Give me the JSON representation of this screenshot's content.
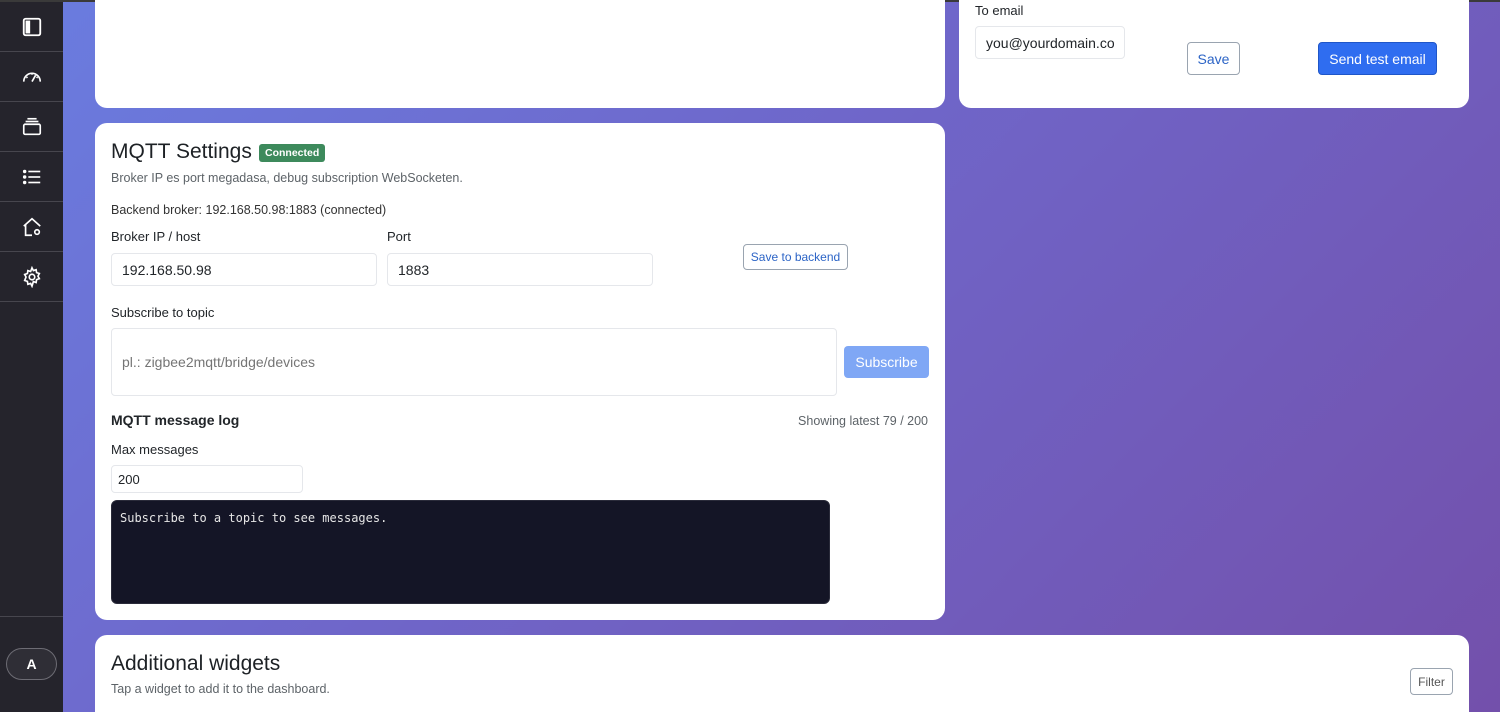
{
  "sidebar": {
    "items": [
      {
        "icon": "sidebar-toggle-icon"
      },
      {
        "icon": "speedometer-icon"
      },
      {
        "icon": "stack-icon"
      },
      {
        "icon": "list-icon"
      },
      {
        "icon": "home-settings-icon"
      },
      {
        "icon": "gear-icon"
      }
    ],
    "avatar_initial": "A"
  },
  "email_card": {
    "to_email_label": "To email",
    "to_email_value": "you@yourdomain.co",
    "save_label": "Save",
    "send_test_label": "Send test email"
  },
  "mqtt": {
    "title": "MQTT Settings",
    "status_badge": "Connected",
    "description": "Broker IP es port megadasa, debug subscription WebSocketen.",
    "backend_broker": "Backend broker: 192.168.50.98:1883 (connected)",
    "broker_label": "Broker IP / host",
    "broker_value": "192.168.50.98",
    "port_label": "Port",
    "port_value": "1883",
    "save_backend_label": "Save to backend",
    "subscribe_label": "Subscribe to topic",
    "subscribe_placeholder": "pl.: zigbee2mqtt/bridge/devices",
    "subscribe_button": "Subscribe",
    "log_title": "MQTT message log",
    "log_count": "Showing latest 79 / 200",
    "max_messages_label": "Max messages",
    "max_messages_value": "200",
    "log_text": "Subscribe to a topic to see messages."
  },
  "widgets": {
    "title": "Additional widgets",
    "subtitle": "Tap a widget to add it to the dashboard.",
    "filter_label": "Filter"
  },
  "colors": {
    "primary": "#2f6df0",
    "badge_green": "#3d8a5c",
    "sidebar_bg": "#25242c"
  }
}
